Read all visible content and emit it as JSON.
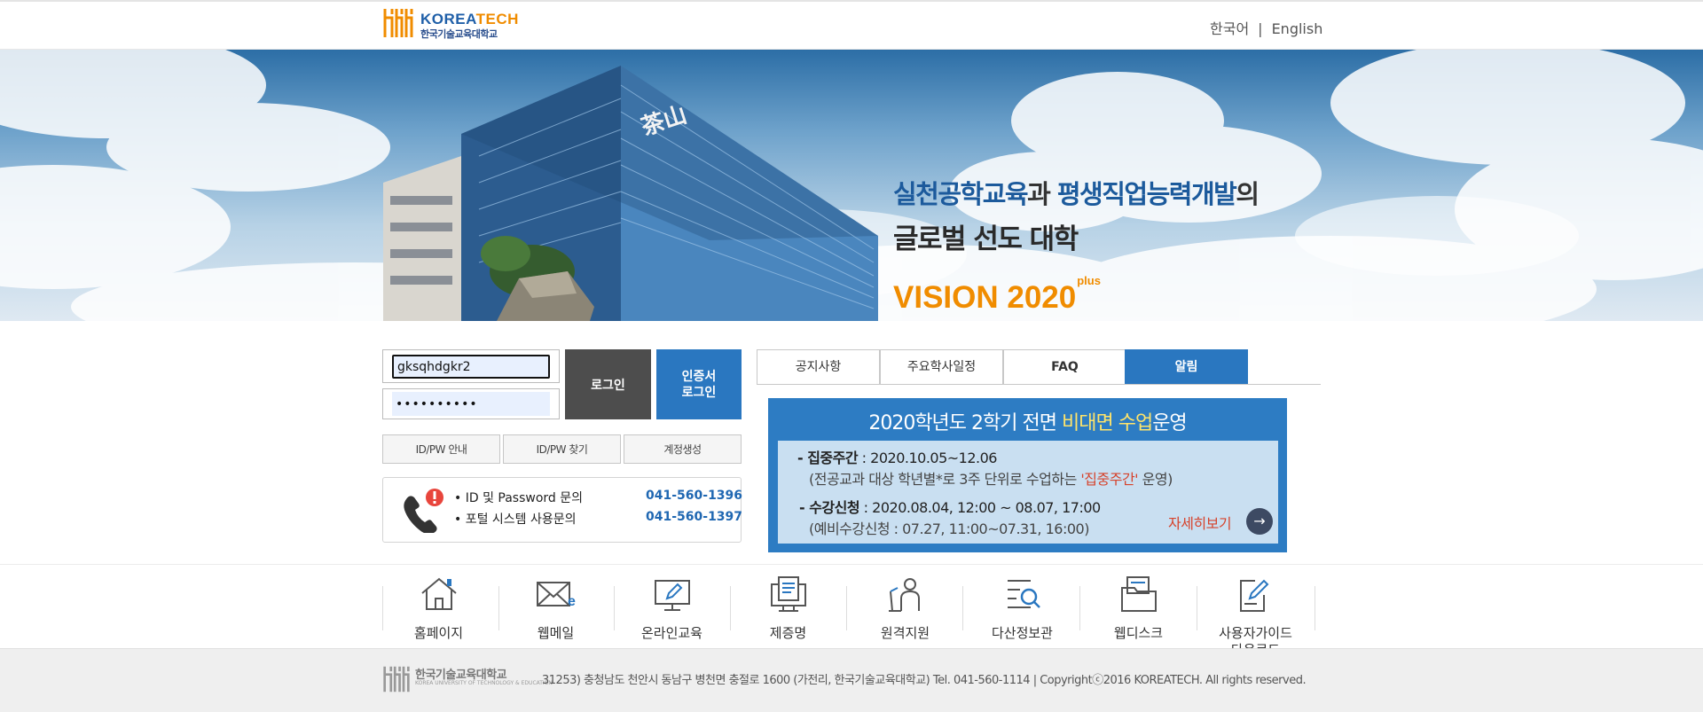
{
  "header": {
    "logo_brand_a": "KOREA",
    "logo_brand_b": "TECH",
    "logo_sub": "한국기술교육대학교",
    "lang_ko": "한국어",
    "lang_sep": "|",
    "lang_en": "English"
  },
  "banner": {
    "line1_a": "실천공학교육",
    "line1_b": "과 ",
    "line1_c": "평생직업능력개발",
    "line1_d": "의",
    "line2": "글로벌 선도 대학",
    "vision": "VISION 2020",
    "vision_sup": "plus",
    "building_sign": "茶山"
  },
  "login": {
    "id_value": "gksqhdgkr2",
    "pw_value": "••••••••••",
    "login_label": "로그인",
    "cert_label": "인증서\n로그인",
    "guide_label": "ID/PW 안내",
    "find_label": "ID/PW 찾기",
    "create_label": "계정생성",
    "contact_1": "• ID 및 Password 문의",
    "contact_2": "• 포털 시스템 사용문의",
    "phone_1": "041-560-1396",
    "phone_2": "041-560-1397"
  },
  "tabs": [
    {
      "label": "공지사항"
    },
    {
      "label": "주요학사일정"
    },
    {
      "label": "FAQ"
    },
    {
      "label": "알림"
    }
  ],
  "notice": {
    "title_a": "2020학년도 2학기 전면 ",
    "title_b": "비대면 수업",
    "title_c": "운영",
    "l1_b": "- 집중주간",
    "l1_t": " : 2020.10.05~12.06",
    "l2_a": "(전공교과 대상 학년별*로 3주 단위로 수업하는 ",
    "l2_r": "'집중주간'",
    "l2_c": " 운영)",
    "l3_b": "- 수강신청",
    "l3_t": " : 2020.08.04, 12:00 ~ 08.07, 17:00",
    "l4": "(예비수강신청 : 07.27, 11:00~07.31, 16:00)",
    "more": "자세히보기",
    "more_arrow": "→"
  },
  "quick": [
    {
      "label": "홈페이지",
      "icon": "home-icon"
    },
    {
      "label": "웹메일",
      "icon": "mail-icon"
    },
    {
      "label": "온라인교육",
      "icon": "monitor-icon"
    },
    {
      "label": "제증명",
      "icon": "certificate-icon"
    },
    {
      "label": "원격지원",
      "icon": "remote-support-icon"
    },
    {
      "label": "다산정보관",
      "icon": "library-search-icon"
    },
    {
      "label": "웹디스크",
      "icon": "folder-icon"
    },
    {
      "label": "사용자가이드\n다운로드",
      "icon": "guide-download-icon"
    }
  ],
  "footer": {
    "name": "한국기술교육대학교",
    "sub": "KOREA UNIVERSITY OF TECHNOLOGY & EDUCATION",
    "address": "31253) 충청남도 천안시 동남구 병천면 충절로 1600 (가전리, 한국기술교육대학교) Tel. 041-560-1114 | Copyrightⓒ2016 KOREATECH. All rights reserved."
  },
  "colors": {
    "brand_blue": "#2a77c0",
    "brand_orange": "#f08c00",
    "login_dark": "#4d4d4d",
    "notice_red": "#d6432c"
  }
}
